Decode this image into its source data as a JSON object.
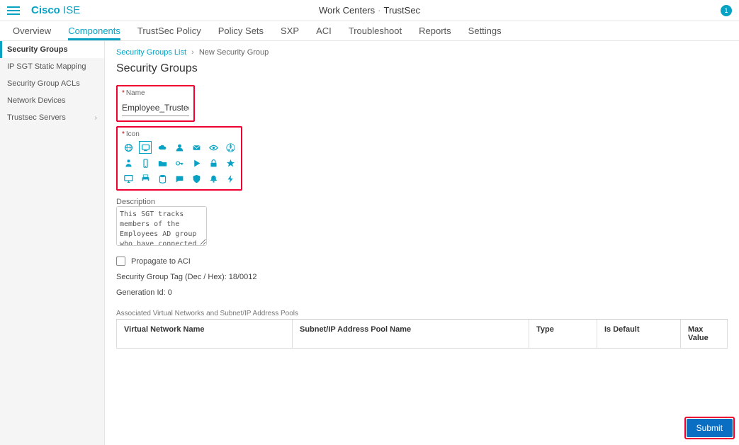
{
  "brand": {
    "cisco": "Cisco",
    "ise": "ISE"
  },
  "page_context": {
    "work_centers": "Work Centers",
    "section": "TrustSec"
  },
  "notifications": {
    "count": "1"
  },
  "tabs": [
    "Overview",
    "Components",
    "TrustSec Policy",
    "Policy Sets",
    "SXP",
    "ACI",
    "Troubleshoot",
    "Reports",
    "Settings"
  ],
  "active_tab": "Components",
  "sidebar": {
    "items": [
      "Security Groups",
      "IP SGT Static Mapping",
      "Security Group ACLs",
      "Network Devices",
      "Trustsec Servers"
    ],
    "active": "Security Groups"
  },
  "crumbs": {
    "root": "Security Groups List",
    "here": "New Security Group"
  },
  "page_title": "Security Groups",
  "form": {
    "name_label": "Name",
    "name_value": "Employee_Trusted_Devices",
    "icon_label": "Icon",
    "desc_label": "Description",
    "desc_value": "This SGT tracks members of the Employees AD group who have connected with a trusted device.",
    "propagate_label": "Propagate to ACI",
    "propagate_checked": false,
    "sgt_line": "Security Group Tag (Dec / Hex): 18/0012",
    "gen_line": "Generation Id: 0"
  },
  "icons": {
    "names": [
      "globe",
      "monitor",
      "cloud",
      "user",
      "envelope",
      "eye",
      "radiation",
      "person",
      "phone",
      "folder",
      "key",
      "play",
      "lock",
      "star",
      "desktop",
      "printer",
      "database",
      "chat",
      "shield",
      "bell",
      "bolt"
    ],
    "selected_index": 1
  },
  "assoc": {
    "title": "Associated Virtual Networks and Subnet/IP Address Pools",
    "cols": [
      "Virtual Network Name",
      "Subnet/IP Address Pool Name",
      "Type",
      "Is Default",
      "Max Value"
    ]
  },
  "actions": {
    "submit": "Submit"
  }
}
